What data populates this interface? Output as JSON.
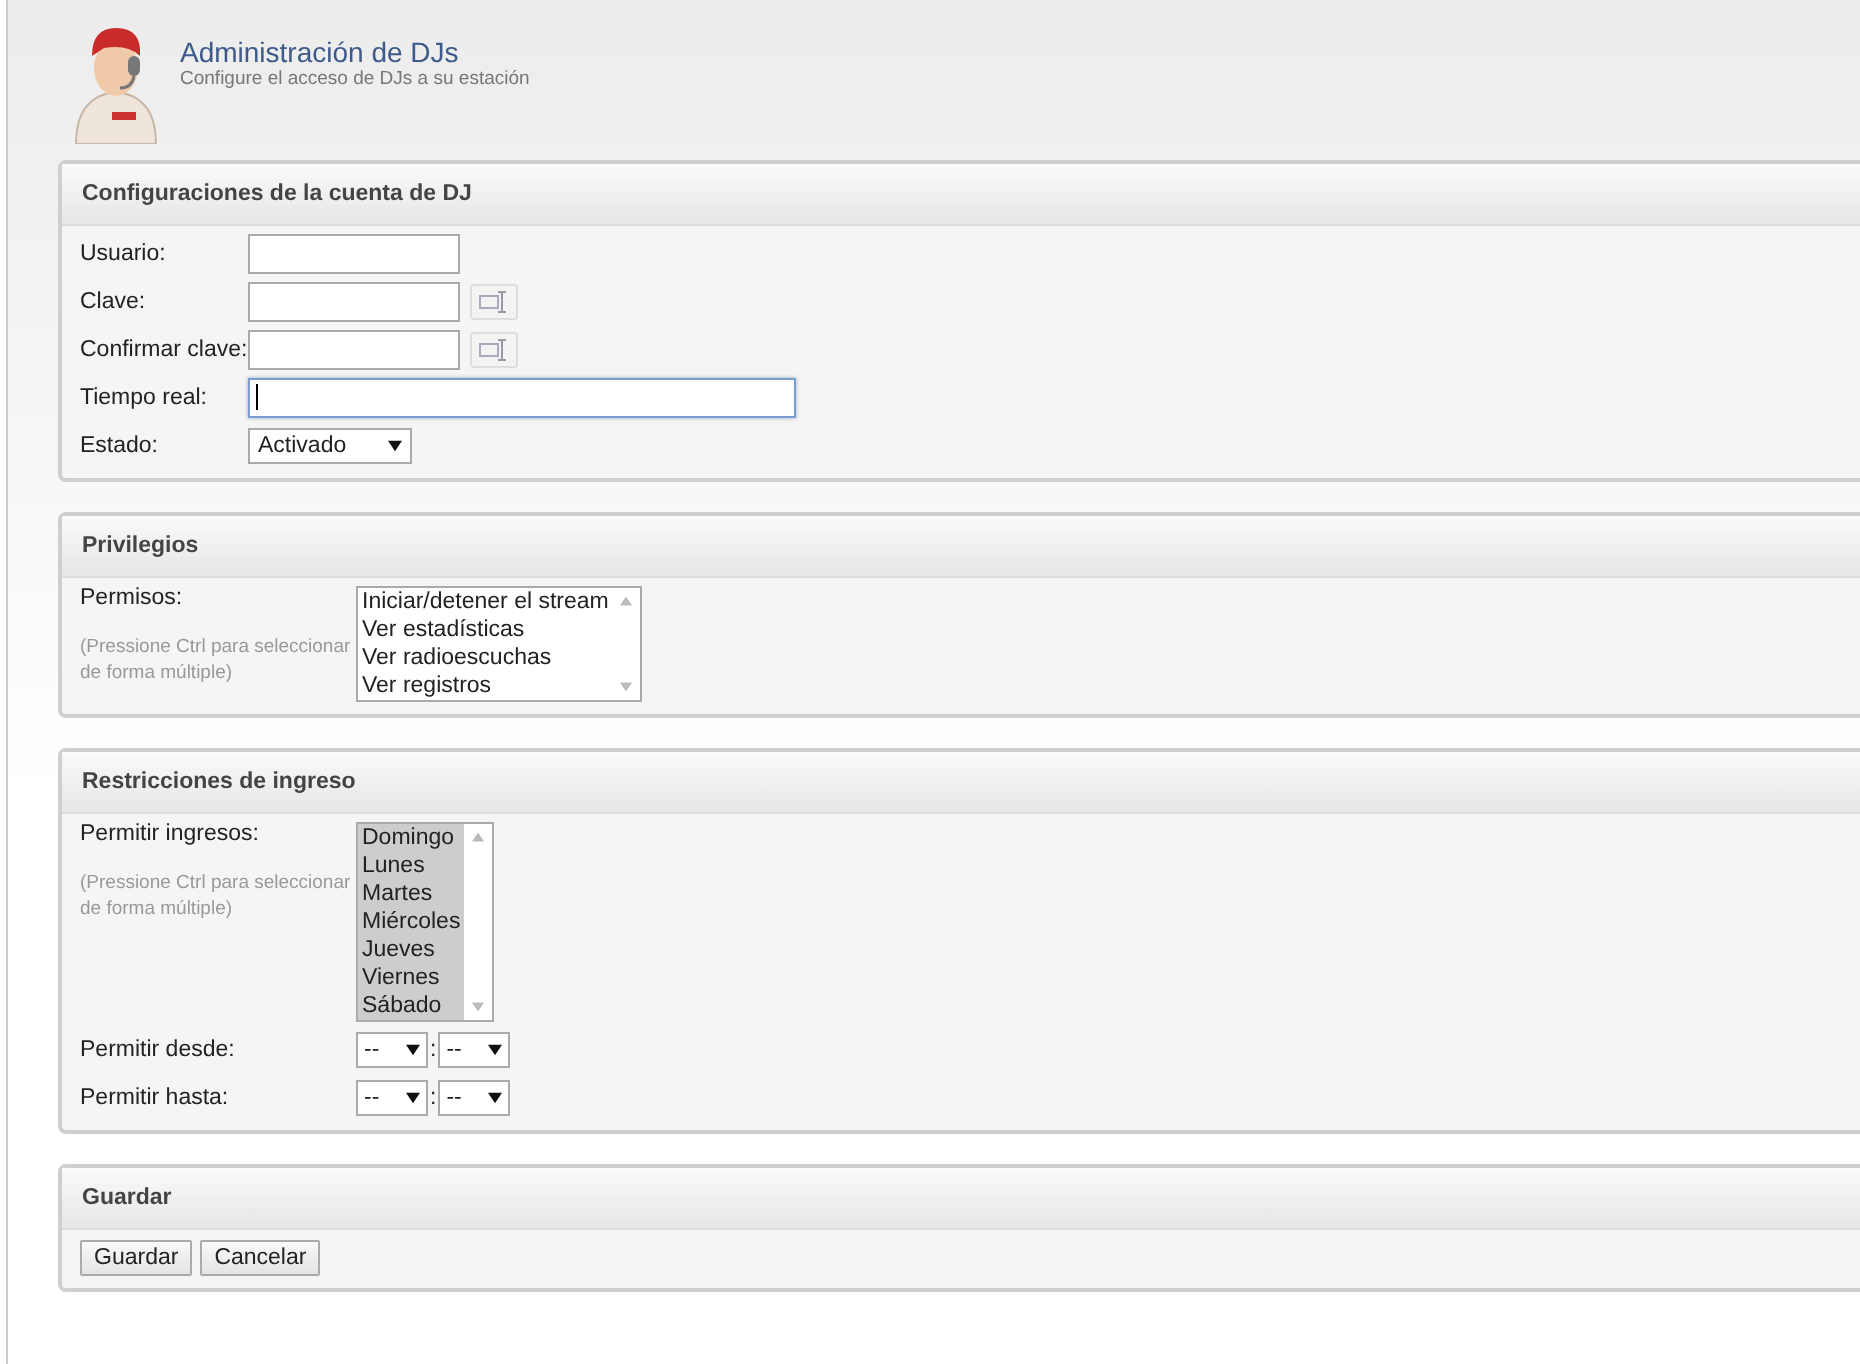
{
  "header": {
    "title": "Administración de DJs",
    "subtitle": "Configure el acceso de DJs a su estación"
  },
  "sections": [
    {
      "title": "Configuraciones de la cuenta de DJ",
      "rows": [
        {
          "kind": "text",
          "label": "Usuario:",
          "focused": false
        },
        {
          "kind": "password",
          "label": "Clave:",
          "focused": false
        },
        {
          "kind": "password",
          "label": "Confirmar clave:",
          "focused": false
        },
        {
          "kind": "wide",
          "label": "Tiempo real:",
          "focused": true
        },
        {
          "kind": "select",
          "label": "Estado:",
          "value": "Activado"
        }
      ]
    },
    {
      "title": "Privilegios",
      "rows": [
        {
          "kind": "listbox",
          "label": "Permisos:",
          "hint": "(Pressione Ctrl para seleccionar de forma múltiple)",
          "options": [
            {
              "label": "Iniciar/detener el stream",
              "selected": false
            },
            {
              "label": "Ver estadísticas",
              "selected": false
            },
            {
              "label": "Ver radioescuchas",
              "selected": false
            },
            {
              "label": "Ver registros",
              "selected": false
            }
          ]
        }
      ]
    },
    {
      "title": "Restricciones de ingreso",
      "rows": [
        {
          "kind": "listbox",
          "label": "Permitir ingresos:",
          "hint": "(Pressione Ctrl para seleccionar de forma múltiple)",
          "options": [
            {
              "label": "Domingo",
              "selected": true
            },
            {
              "label": "Lunes",
              "selected": true
            },
            {
              "label": "Martes",
              "selected": true
            },
            {
              "label": "Miércoles",
              "selected": true
            },
            {
              "label": "Jueves",
              "selected": true
            },
            {
              "label": "Viernes",
              "selected": true
            },
            {
              "label": "Sábado",
              "selected": true
            }
          ]
        },
        {
          "kind": "time",
          "label": "Permitir desde:",
          "hours": "--",
          "separator": ":",
          "minutes": "--"
        },
        {
          "kind": "time",
          "label": "Permitir hasta:",
          "hours": "--",
          "separator": ":",
          "minutes": "--"
        }
      ]
    },
    {
      "title": "Guardar",
      "rows": [
        {
          "kind": "buttons",
          "buttons": [
            "Guardar",
            "Cancelar"
          ]
        }
      ]
    }
  ]
}
